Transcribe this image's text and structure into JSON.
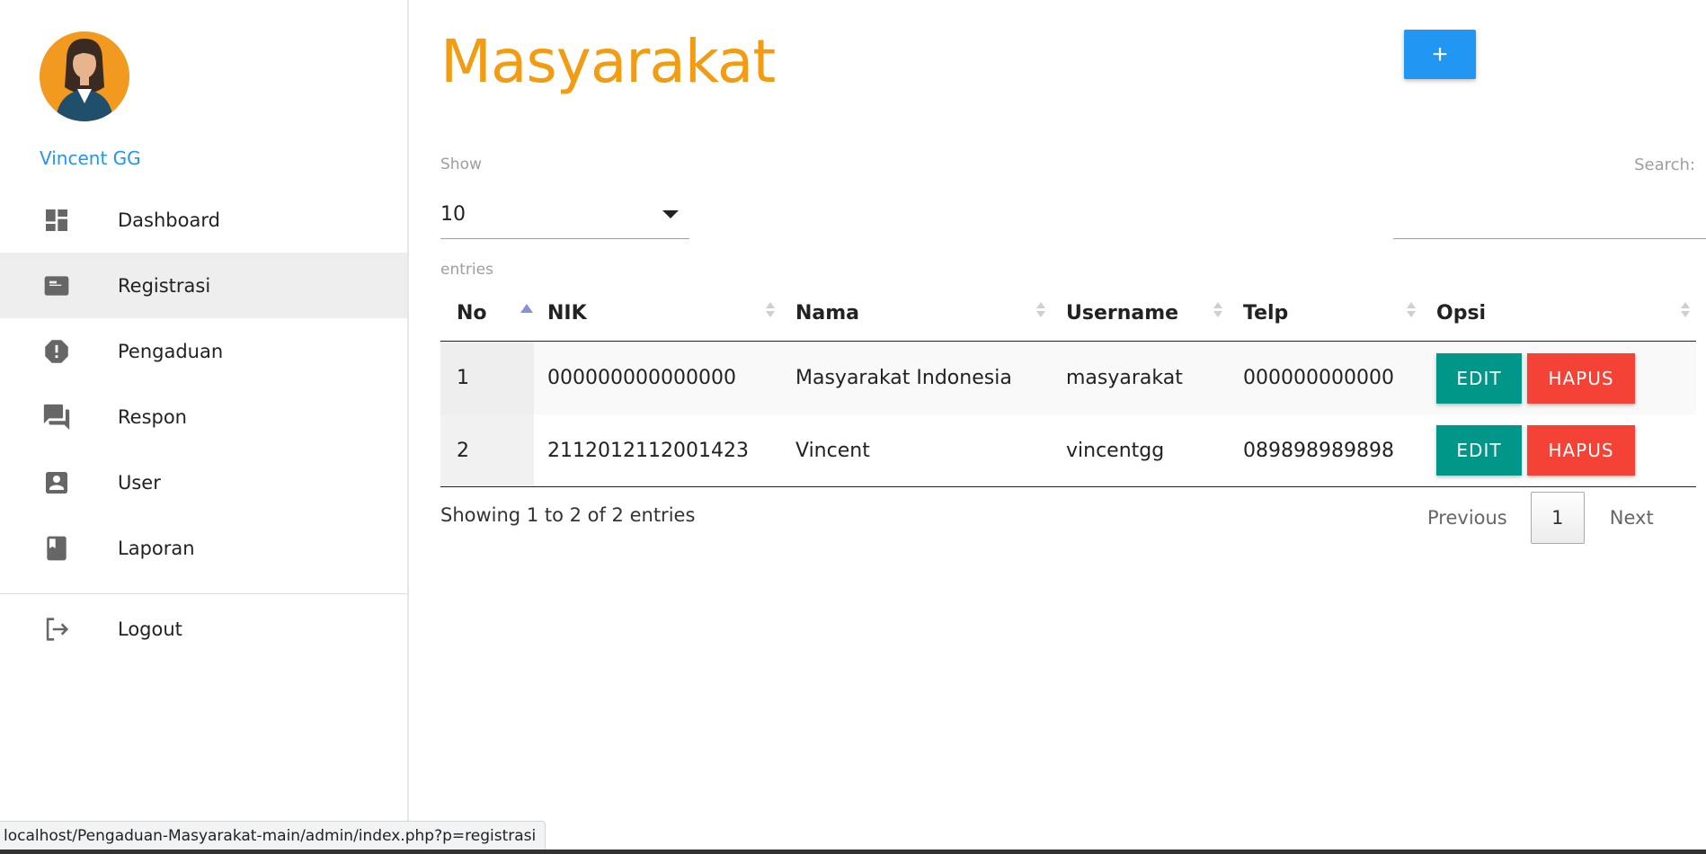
{
  "sidebar": {
    "user_name": "Vincent GG",
    "items": [
      {
        "label": "Dashboard",
        "icon": "dashboard-icon"
      },
      {
        "label": "Registrasi",
        "icon": "card-icon"
      },
      {
        "label": "Pengaduan",
        "icon": "report-icon"
      },
      {
        "label": "Respon",
        "icon": "forum-icon"
      },
      {
        "label": "User",
        "icon": "account-box-icon"
      },
      {
        "label": "Laporan",
        "icon": "book-icon"
      }
    ],
    "logout": {
      "label": "Logout",
      "icon": "logout-icon"
    },
    "active_item": "Registrasi"
  },
  "main": {
    "title": "Masyarakat",
    "add_button": "+",
    "show_label": "Show",
    "entries_select": "10",
    "entries_label": "entries",
    "search_label": "Search:",
    "search_value": "",
    "table": {
      "columns": [
        "No",
        "NIK",
        "Nama",
        "Username",
        "Telp",
        "Opsi"
      ],
      "rows": [
        {
          "no": "1",
          "nik": "000000000000000",
          "nama": "Masyarakat Indonesia",
          "username": "masyarakat",
          "telp": "000000000000"
        },
        {
          "no": "2",
          "nik": "2112012112001423",
          "nama": "Vincent",
          "username": "vincentgg",
          "telp": "089898989898"
        }
      ],
      "edit_label": "EDIT",
      "hapus_label": "HAPUS"
    },
    "info": "Showing 1 to 2 of 2 entries",
    "pager": {
      "previous": "Previous",
      "page": "1",
      "next": "Next"
    }
  },
  "status_bar": "localhost/Pengaduan-Masyarakat-main/admin/index.php?p=registrasi",
  "colors": {
    "title": "#f39c12",
    "accent_blue": "#2196f3",
    "edit": "#009688",
    "hapus": "#f44336",
    "avatar_bg": "#f29a1f"
  }
}
